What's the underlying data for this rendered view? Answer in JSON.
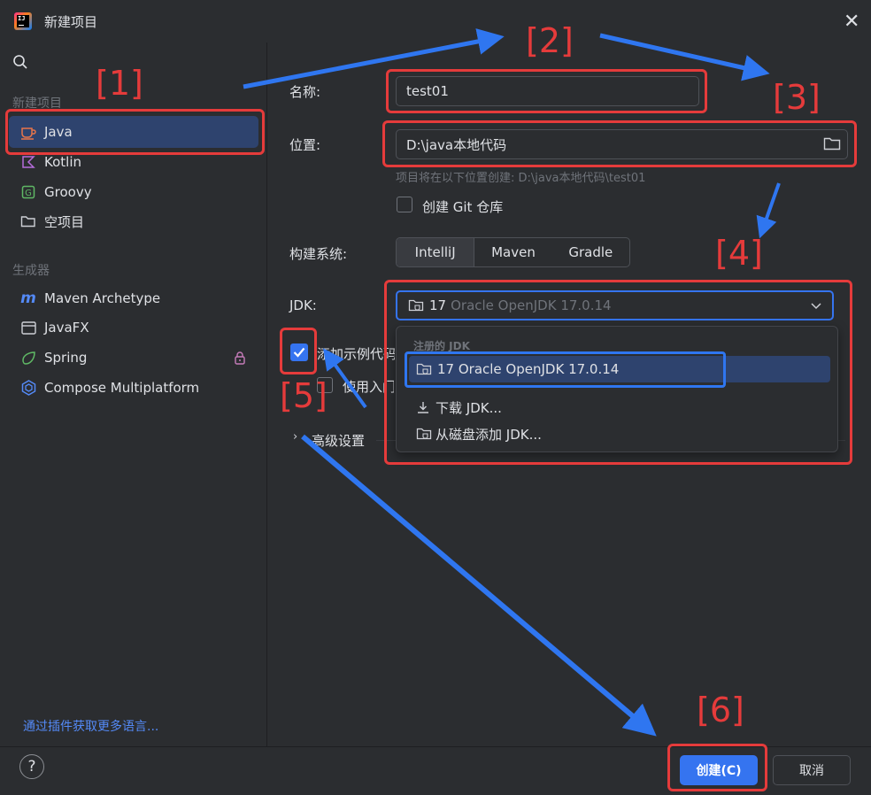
{
  "window": {
    "title": "新建项目",
    "close_icon": "close-icon"
  },
  "sidebar": {
    "section_new": "新建项目",
    "section_generators": "生成器",
    "items": [
      {
        "label": "Java",
        "icon": "java-icon",
        "selected": true
      },
      {
        "label": "Kotlin",
        "icon": "kotlin-icon"
      },
      {
        "label": "Groovy",
        "icon": "groovy-icon"
      },
      {
        "label": "空项目",
        "icon": "folder-icon"
      }
    ],
    "generators": [
      {
        "label": "Maven Archetype",
        "icon": "maven-icon"
      },
      {
        "label": "JavaFX",
        "icon": "javafx-icon"
      },
      {
        "label": "Spring",
        "icon": "spring-icon",
        "locked": true
      },
      {
        "label": "Compose Multiplatform",
        "icon": "compose-icon"
      }
    ],
    "plugins_link": "通过插件获取更多语言..."
  },
  "form": {
    "name_label": "名称:",
    "name_value": "test01",
    "location_label": "位置:",
    "location_value": "D:\\java本地代码",
    "location_hint": "项目将在以下位置创建: D:\\java本地代码\\test01",
    "git_checkbox": "创建 Git 仓库",
    "build_label": "构建系统:",
    "build_options": [
      "IntelliJ",
      "Maven",
      "Gradle"
    ],
    "build_selected": "IntelliJ",
    "jdk_label": "JDK:",
    "jdk_version": "17",
    "jdk_name": "Oracle OpenJDK 17.0.14",
    "sample_code_checkbox": "添加示例代码",
    "onboarding_checkbox": "使用入门",
    "advanced_label": "高级设置"
  },
  "jdk_dropdown": {
    "header": "注册的 JDK",
    "selected_item": "17 Oracle OpenJDK 17.0.14",
    "download": "下载 JDK...",
    "add_from_disk": "从磁盘添加 JDK..."
  },
  "footer": {
    "help": "?",
    "create": "创建(C)",
    "cancel": "取消"
  },
  "annotations": {
    "step1": "[1]",
    "step2": "[2]",
    "step3": "[3]",
    "step4": "[4]",
    "step5": "[5]",
    "step6": "[6]"
  },
  "colors": {
    "background": "#2b2d30",
    "accent": "#3574f0",
    "selection": "#2e436e",
    "annotation_red": "#e53b3b",
    "annotation_blue": "#2f76f0"
  }
}
